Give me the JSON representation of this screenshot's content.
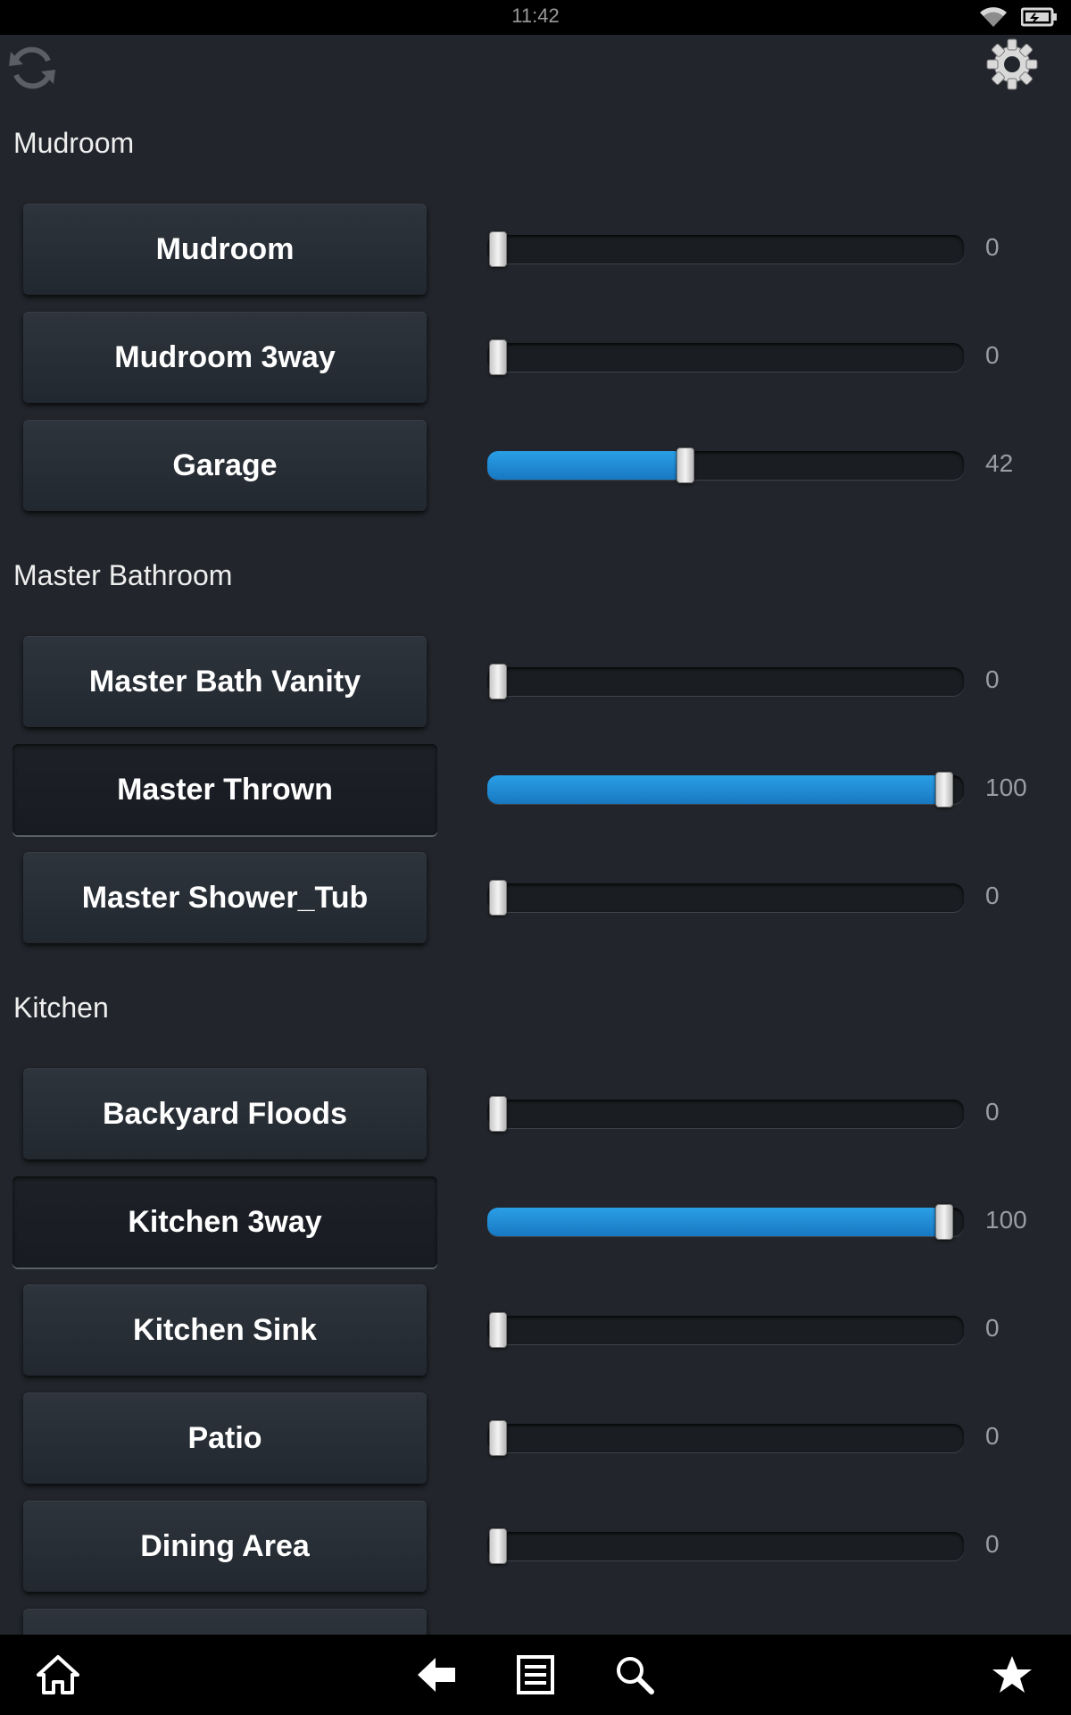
{
  "status_bar": {
    "time": "11:42",
    "icons": [
      "wifi-icon",
      "battery-icon"
    ]
  },
  "toolbar": {
    "left_icon": "refresh-icon",
    "right_icon": "gear-icon"
  },
  "colors": {
    "background": "#22252b",
    "slider_fill": "#1e8fd8",
    "status_bar": "#000000"
  },
  "sections": [
    {
      "title": "Mudroom",
      "devices": [
        {
          "label": "Mudroom",
          "level": 0,
          "level_text": "0",
          "on": false
        },
        {
          "label": "Mudroom 3way",
          "level": 0,
          "level_text": "0",
          "on": false
        },
        {
          "label": "Garage",
          "level": 42,
          "level_text": "42",
          "on": false
        }
      ]
    },
    {
      "title": "Master Bathroom",
      "devices": [
        {
          "label": "Master Bath Vanity",
          "level": 0,
          "level_text": "0",
          "on": false
        },
        {
          "label": "Master Thrown",
          "level": 100,
          "level_text": "100",
          "on": true
        },
        {
          "label": "Master Shower_Tub",
          "level": 0,
          "level_text": "0",
          "on": false
        }
      ]
    },
    {
      "title": "Kitchen",
      "devices": [
        {
          "label": "Backyard Floods",
          "level": 0,
          "level_text": "0",
          "on": false
        },
        {
          "label": "Kitchen 3way",
          "level": 100,
          "level_text": "100",
          "on": true
        },
        {
          "label": "Kitchen Sink",
          "level": 0,
          "level_text": "0",
          "on": false
        },
        {
          "label": "Patio",
          "level": 0,
          "level_text": "0",
          "on": false
        },
        {
          "label": "Dining Area",
          "level": 0,
          "level_text": "0",
          "on": false
        }
      ]
    }
  ],
  "nav": [
    "home-icon",
    "back-icon",
    "list-icon",
    "search-icon",
    "star-icon"
  ]
}
